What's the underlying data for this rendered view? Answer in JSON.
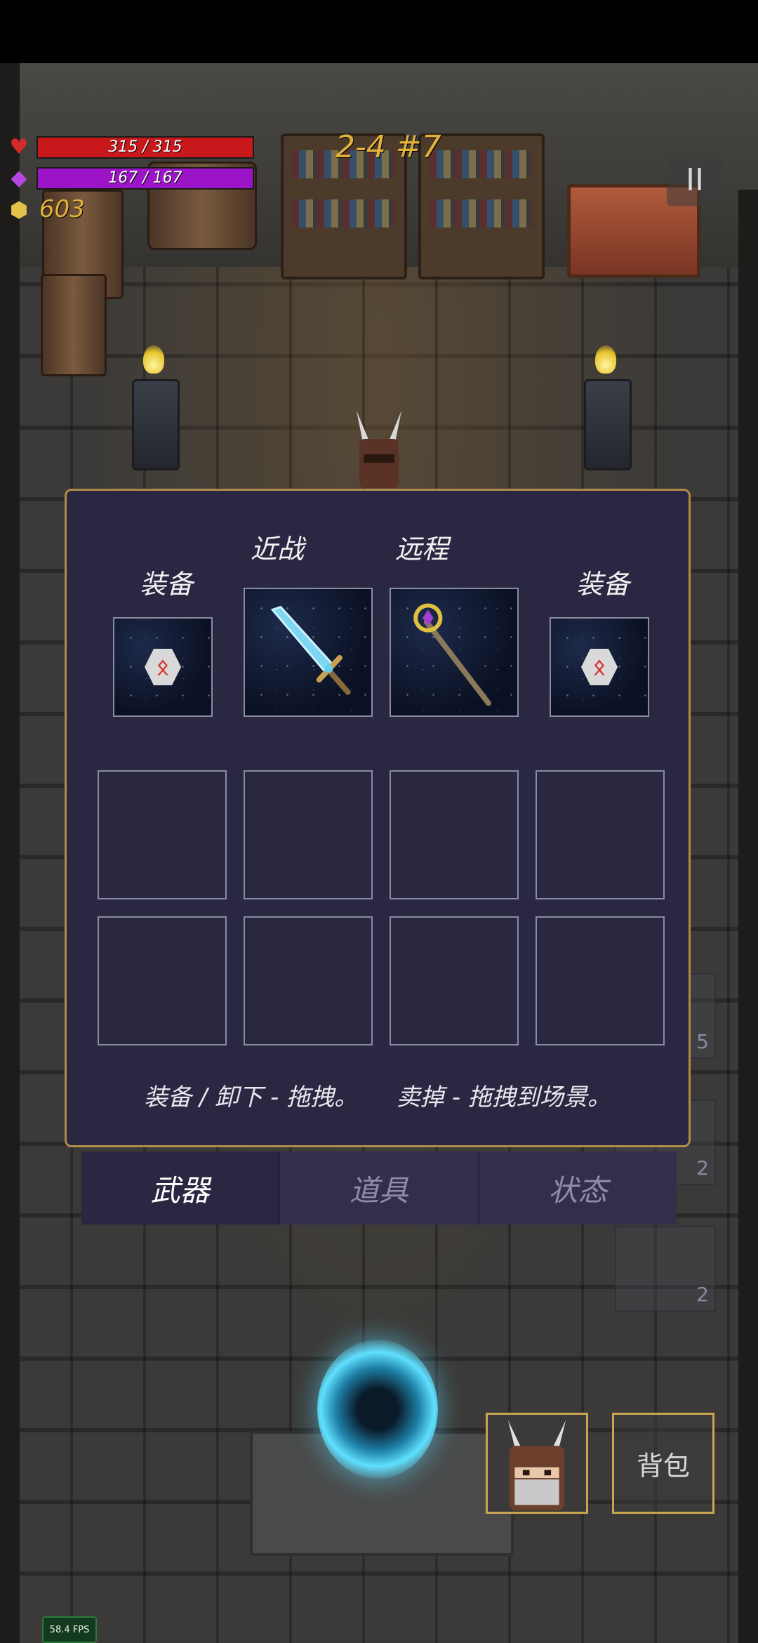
{
  "hud": {
    "hp_text": "315 / 315",
    "hp_fraction": 1.0,
    "mp_text": "167 / 167",
    "mp_fraction": 1.0,
    "gold": "603",
    "level": "2-4 #7",
    "pause_icon": "pause-icon"
  },
  "inventory": {
    "left_equip_label": "装备",
    "melee_label": "近战",
    "ranged_label": "远程",
    "right_equip_label": "装备",
    "left_equip_rune": "ᛟ",
    "right_equip_rune": "ᛟ",
    "melee_item_icon": "sword-icon",
    "ranged_item_icon": "staff-icon",
    "hint_equip": "装备 / 卸下 - 拖拽。",
    "hint_sell": "卖掉 - 拖拽到场景。"
  },
  "tabs": [
    {
      "label": "武器",
      "active": true
    },
    {
      "label": "道具",
      "active": false
    },
    {
      "label": "状态",
      "active": false
    }
  ],
  "side_counts": [
    "5",
    "2",
    "2"
  ],
  "bag_label": "背包",
  "fps": "58.4 FPS",
  "colors": {
    "hp_bar": "#c8181c",
    "mp_bar": "#9b14c8",
    "gold_text": "#e3b23b",
    "panel_bg": "#292741",
    "panel_border": "#b08c4a"
  }
}
